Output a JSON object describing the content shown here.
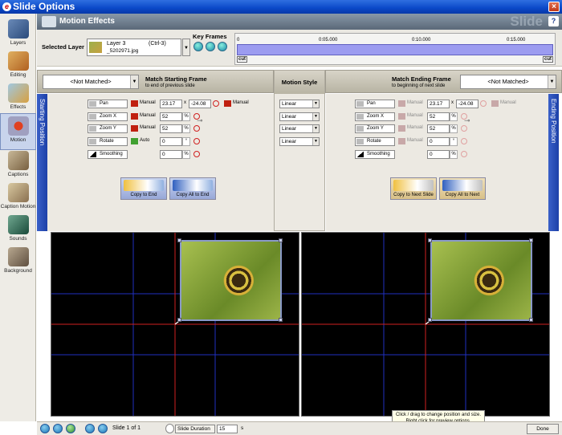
{
  "window": {
    "title": "Slide Options",
    "close_icon": "×"
  },
  "sidebar": {
    "items": [
      {
        "label": "Layers",
        "active": false
      },
      {
        "label": "Editing",
        "active": false
      },
      {
        "label": "Effects",
        "active": false
      },
      {
        "label": "Motion",
        "active": true
      },
      {
        "label": "Captions",
        "active": false
      },
      {
        "label": "Caption Motion",
        "active": false
      },
      {
        "label": "Sounds",
        "active": false
      },
      {
        "label": "Background",
        "active": false
      }
    ]
  },
  "header": {
    "title": "Motion Effects",
    "watermark": "Slide",
    "help": "?"
  },
  "layer": {
    "selected_label": "Selected Layer",
    "name": "Layer 3",
    "shortcut": "(Ctrl-3)",
    "file": "_5202971.jpg"
  },
  "keyframes": {
    "label": "Key Frames",
    "ticks": [
      "0",
      "0:05.000",
      "0:10.000",
      "0:15.000"
    ],
    "cut_label": "cut"
  },
  "start": {
    "match_value": "<Not Matched>",
    "title": "Match Starting Frame",
    "subtitle": "to end of previous slide",
    "vertical_label": "Starting Position",
    "rows": [
      {
        "label": "Pan",
        "mode": "Manual",
        "v1": "23.17",
        "v2": "-24.08",
        "mode2": "Manual"
      },
      {
        "label": "Zoom X",
        "mode": "Manual",
        "v1": "52",
        "unit": "%"
      },
      {
        "label": "Zoom Y",
        "mode": "Manual",
        "v1": "52",
        "unit": "%"
      },
      {
        "label": "Rotate",
        "mode": "Auto",
        "v1": "0",
        "unit": "°"
      },
      {
        "label": "Smoothing",
        "v1": "0",
        "unit": "%"
      }
    ],
    "copy_buttons": [
      "Copy to End",
      "Copy All to End"
    ]
  },
  "motion_style": {
    "title": "Motion Style",
    "values": [
      "Linear",
      "Linear",
      "Linear",
      "Linear"
    ]
  },
  "end": {
    "match_value": "<Not Matched>",
    "title": "Match Ending Frame",
    "subtitle": "to beginning of next slide",
    "vertical_label": "Ending Position",
    "rows": [
      {
        "label": "Pan",
        "mode": "Manual",
        "v1": "23.17",
        "v2": "-24.08",
        "mode2": "Manual"
      },
      {
        "label": "Zoom X",
        "mode": "Manual",
        "v1": "52",
        "unit": "%"
      },
      {
        "label": "Zoom Y",
        "mode": "Manual",
        "v1": "52",
        "unit": "%"
      },
      {
        "label": "Rotate",
        "mode": "Manual",
        "v1": "0",
        "unit": "°"
      },
      {
        "label": "Smoothing",
        "v1": "0",
        "unit": "%"
      }
    ],
    "copy_buttons": [
      "Copy to Next Slide",
      "Copy All to Next"
    ]
  },
  "tooltip": {
    "line1": "Click / drag to change position and size.",
    "line2": "Right click for preview options."
  },
  "bottom": {
    "slide_text": "Slide 1 of 1",
    "duration_label": "Slide Duration",
    "duration_value": "15",
    "duration_unit": "s",
    "done": "Done"
  },
  "colors": {
    "accent": "#0a48c8",
    "timeline": "#9c9cf0",
    "preview_bg": "#000000",
    "grid_blue": "#2030c0",
    "grid_red": "#d02020"
  }
}
